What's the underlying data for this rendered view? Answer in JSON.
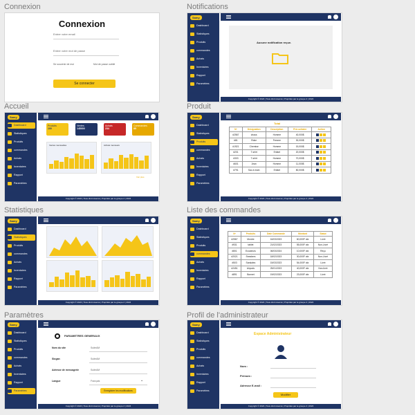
{
  "labels": {
    "login": "Connexion",
    "notifications": "Notifications",
    "home": "Accueil",
    "product": "Produit",
    "stats": "Statistiques",
    "orders": "Liste des commandes",
    "settings": "Paramètres",
    "profile": "Profil de l'administrateur"
  },
  "app": {
    "logo": "Samy",
    "footer": "Copyright © 2024 | Tous droit réservé | Propriété par le groupe 2 | 2024"
  },
  "nav": {
    "dashboard": "Dashboard",
    "stats": "Statistiques",
    "products": "Produits",
    "orders": "commandes",
    "purchases": "Achats",
    "inventory": "Inventaires",
    "report": "Rapport",
    "settings": "Paramètres"
  },
  "login": {
    "title": "Connexion",
    "email_placeholder": "Entrer votre email",
    "password_placeholder": "Entrer votre mot de passe",
    "remember": "Se souvenir de moi",
    "forgot": "Mot de passe oublié",
    "submit": "Se connecter"
  },
  "notifications": {
    "empty": "Aucune notification reçue."
  },
  "home": {
    "cards": [
      {
        "label": "Produits",
        "value": "100"
      },
      {
        "label": "Ventes",
        "value": "145000"
      },
      {
        "label": "Achats",
        "value": "234"
      },
      {
        "label": "Commandes",
        "value": "85"
      }
    ],
    "chart_left": "Ventes mensuelles",
    "chart_right": "Achats mensuels",
    "more": "Voir plus"
  },
  "product": {
    "total": "Total",
    "headers": [
      "Nº",
      "Désignation",
      "Description",
      "Prix unitaire",
      "Action"
    ],
    "rows": [
      [
        "#2567",
        "chaus",
        "Homme",
        "40,000$"
      ],
      [
        "#81",
        "Robe",
        "Femme",
        "30,000$"
      ],
      [
        "#1921",
        "Chemise",
        "Homme",
        "15,000$"
      ],
      [
        "#201",
        "T-shirt",
        "Enfant",
        "20,000$"
      ],
      [
        "#303",
        "T-shirt",
        "Homme",
        "70,000$"
      ],
      [
        "#601",
        "Jean",
        "Homme",
        "11,000$"
      ],
      [
        "#791",
        "Sac à main",
        "Enfant",
        "80,000$"
      ]
    ]
  },
  "orders": {
    "headers": [
      "Nº",
      "Produits",
      "Date Commande",
      "Montant",
      "Statut"
    ],
    "rows": [
      [
        "#2567",
        "Montre",
        "16/03/2023",
        "60,000F cfa",
        "Livré"
      ],
      [
        "#931",
        "tablet",
        "21/02/2023",
        "55,000F cfa",
        "Non-Livré"
      ],
      [
        "#801",
        "Ecouteurs",
        "06/03/2024",
        "10,000F cfa",
        "Reçu"
      ],
      [
        "#2021",
        "Sneakers",
        "18/02/2023",
        "30,000F cfa",
        "Non-Livré"
      ],
      [
        "#503",
        "Sandales",
        "15/03/2023",
        "54,000F cfa",
        "Livré"
      ],
      [
        "#2451",
        "Airpods",
        "25/01/2023",
        "40,000F cfa",
        "Non-livré"
      ],
      [
        "#891",
        "Bonnet",
        "19/02/2023",
        "23,000F cfa",
        "Livré"
      ]
    ]
  },
  "settings": {
    "title": "PARAMETRES GENERAUX",
    "fields": [
      {
        "label": "Nom du site",
        "value": "SuiteAM"
      },
      {
        "label": "Slogan",
        "value": "SuiteAM"
      },
      {
        "label": "Adresse de messagerie",
        "value": "SuiteAM"
      },
      {
        "label": "Langue",
        "value": "Français"
      }
    ],
    "save": "Enregistrer les modifications"
  },
  "profile": {
    "title": "Espace Administrateur",
    "name": "Nom :",
    "first_name": "Prénom :",
    "email": "Adresse E-mail :",
    "edit": "Modifier"
  },
  "colors": {
    "navy": "#1f3464",
    "yellow": "#f5c518",
    "red": "#c62828"
  }
}
